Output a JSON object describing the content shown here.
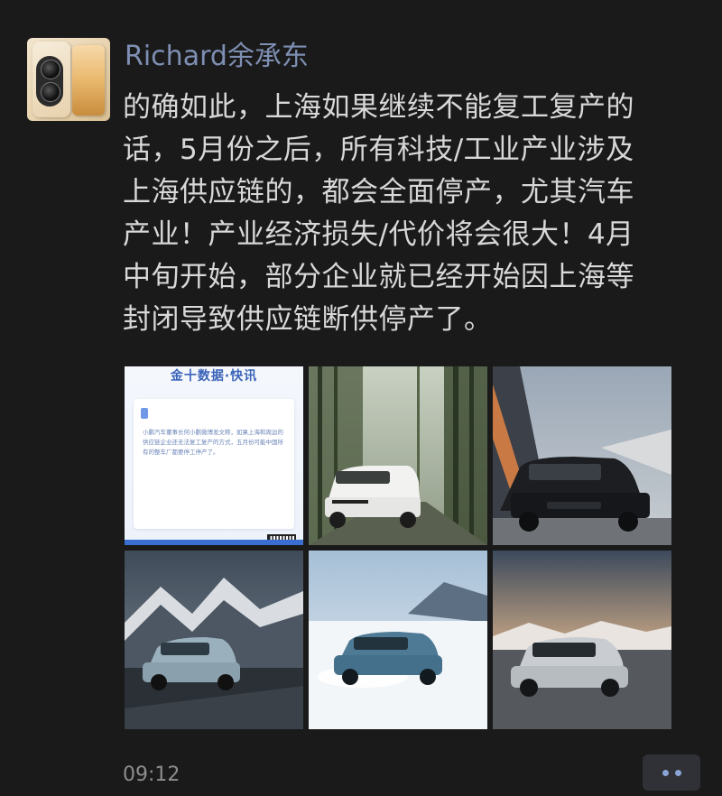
{
  "post": {
    "author": "Richard余承东",
    "text": "的确如此，上海如果继续不能复工复产的\n话，5月份之后，所有科技/工业产业涉及\n上海供应链的，都会全面停产，尤其汽车\n产业！产业经济损失/代价将会很大！4月\n中旬开始，部分企业就已经开始因上海等\n封闭导致供应链断供停产了。",
    "time": "09:12"
  },
  "images": [
    {
      "kind": "news-screenshot",
      "header": "金十数据·快讯",
      "body": "小鹏汽车董事长何小鹏微博发文称，如果上海和周边的供应链企业还无法复工复产的方式，五月份可能中国所有的整车厂都要停工停产了。"
    },
    {
      "kind": "photo",
      "subject": "white SUV on road between bamboo trees"
    },
    {
      "kind": "photo",
      "subject": "black SUV beside modern architecture"
    },
    {
      "kind": "photo",
      "subject": "blue-gray SUV driving in snowy mountains"
    },
    {
      "kind": "photo",
      "subject": "blue SUV drifting on snow field"
    },
    {
      "kind": "photo",
      "subject": "silver SUV on mountain road at sunset"
    }
  ],
  "icons": {
    "more": "more-dots-icon"
  },
  "colors": {
    "background": "#1a1a1a",
    "author_link": "#7e8fb3",
    "text": "#d8d8d8",
    "timestamp": "#8e8e8e",
    "more_dots": "#8aa4d6"
  }
}
